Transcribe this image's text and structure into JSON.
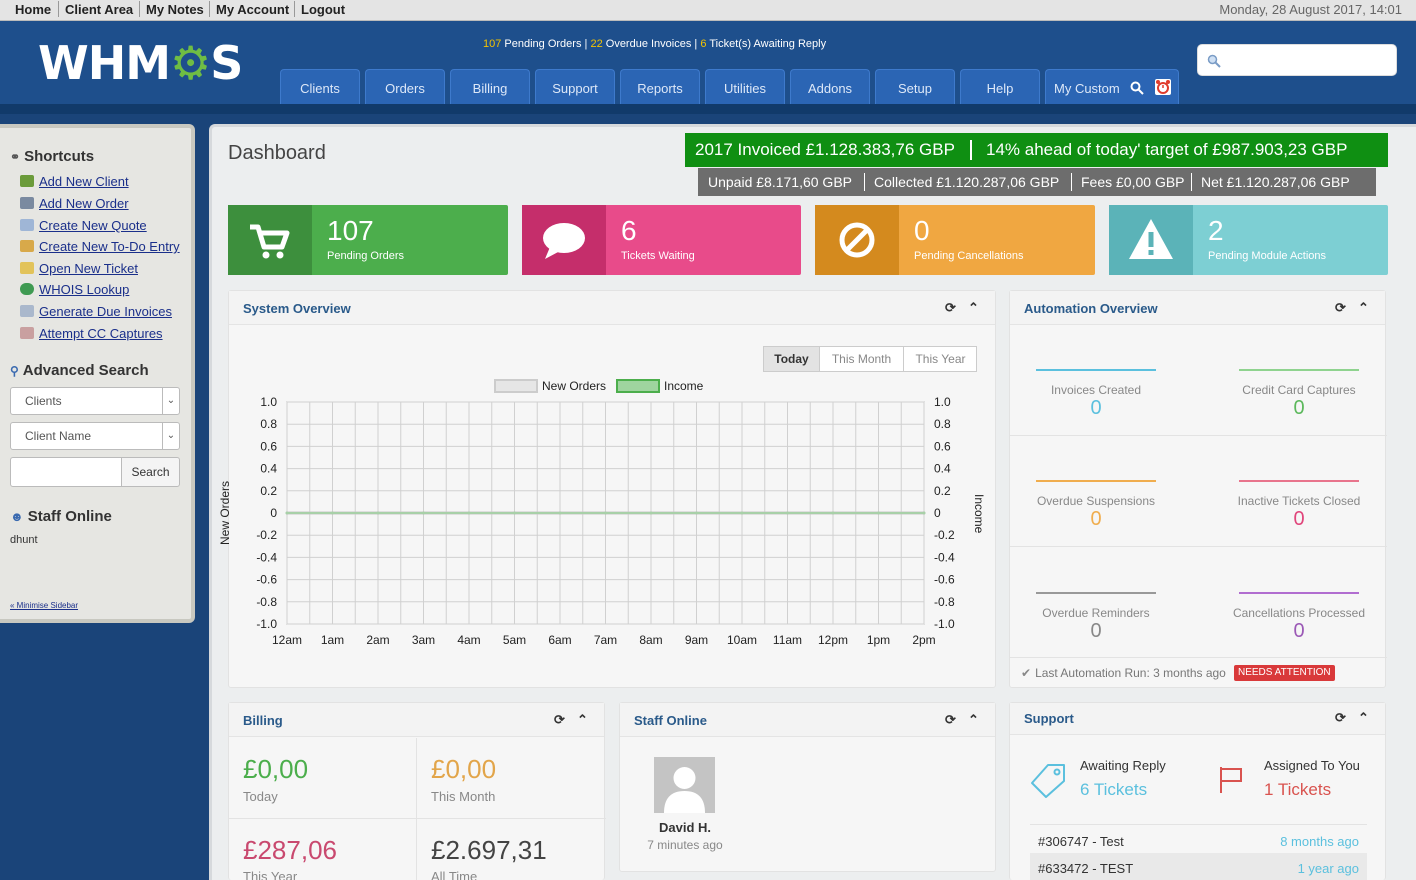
{
  "topnav": {
    "home": "Home",
    "client_area": "Client Area",
    "my_notes": "My Notes",
    "my_account": "My Account",
    "logout": "Logout",
    "datetime": "Monday, 28 August 2017, 14:01"
  },
  "header": {
    "logo_pre": "WHM",
    "logo_gear": "⚙",
    "logo_post": "S",
    "alerts": {
      "pending_orders_n": "107",
      "pending_orders": " Pending Orders",
      "overdue_n": "22",
      "overdue": " Overdue Invoices",
      "tickets_n": "6",
      "tickets": " Ticket(s) Awaiting Reply",
      "sep": " | "
    },
    "tabs": [
      "Clients",
      "Orders",
      "Billing",
      "Support",
      "Reports",
      "Utilities",
      "Addons",
      "Setup",
      "Help",
      "My Custom"
    ]
  },
  "sidebar": {
    "shortcuts_title": "Shortcuts",
    "links": [
      "Add New Client",
      "Add New Order",
      "Create New Quote",
      "Create New To-Do Entry",
      "Open New Ticket",
      "WHOIS Lookup",
      "Generate Due Invoices",
      "Attempt CC Captures"
    ],
    "advanced_search": "Advanced Search",
    "select1": "Clients",
    "select2": "Client Name",
    "search_btn": "Search",
    "staff_online": "Staff Online",
    "staff_name": "dhunt",
    "minimise": "« Minimise Sidebar"
  },
  "dashboard": {
    "title": "Dashboard",
    "invoiced": "2017 Invoiced £1.128.383,76 GBP",
    "ahead": "14% ahead of today' target of £987.903,23 GBP",
    "unpaid": "Unpaid £8.171,60 GBP",
    "collected": "Collected £1.120.287,06 GBP",
    "fees": "Fees £0,00 GBP",
    "net": "Net £1.120.287,06 GBP",
    "stats": [
      {
        "num": "107",
        "label": "Pending Orders"
      },
      {
        "num": "6",
        "label": "Tickets Waiting"
      },
      {
        "num": "0",
        "label": "Pending Cancellations"
      },
      {
        "num": "2",
        "label": "Pending Module Actions"
      }
    ]
  },
  "system_overview": {
    "title": "System Overview",
    "ranges": [
      "Today",
      "This Month",
      "This Year"
    ],
    "legend1": "New Orders",
    "legend2": "Income"
  },
  "chart_data": {
    "type": "line",
    "x": [
      "12am",
      "1am",
      "2am",
      "3am",
      "4am",
      "5am",
      "6am",
      "7am",
      "8am",
      "9am",
      "10am",
      "11am",
      "12pm",
      "1pm",
      "2pm"
    ],
    "y_ticks": [
      "1.0",
      "0.8",
      "0.6",
      "0.4",
      "0.2",
      "0",
      "-0.2",
      "-0.4",
      "-0.6",
      "-0.8",
      "-1.0"
    ],
    "series": [
      {
        "name": "New Orders",
        "values": [
          0,
          0,
          0,
          0,
          0,
          0,
          0,
          0,
          0,
          0,
          0,
          0,
          0,
          0,
          0
        ]
      },
      {
        "name": "Income",
        "values": [
          0,
          0,
          0,
          0,
          0,
          0,
          0,
          0,
          0,
          0,
          0,
          0,
          0,
          0,
          0
        ]
      }
    ],
    "ylabel": "New Orders",
    "y2label": "Income",
    "ylim": [
      -1,
      1
    ],
    "grid": true,
    "legend": "top-center"
  },
  "automation": {
    "title": "Automation Overview",
    "items": [
      {
        "label": "Invoices Created",
        "value": "0",
        "color": "#5bc0de"
      },
      {
        "label": "Credit Card Captures",
        "value": "0",
        "color": "#5cb85c"
      },
      {
        "label": "Overdue Suspensions",
        "value": "0",
        "color": "#f0ad4e"
      },
      {
        "label": "Inactive Tickets Closed",
        "value": "0",
        "color": "#d9534f"
      },
      {
        "label": "Overdue Reminders",
        "value": "0",
        "color": "#777777"
      },
      {
        "label": "Cancellations Processed",
        "value": "0",
        "color": "#9b59b6"
      }
    ],
    "last_run": "Last Automation Run: 3 months ago",
    "needs": "NEEDS ATTENTION"
  },
  "billing": {
    "title": "Billing",
    "today_v": "£0,00",
    "today": "Today",
    "month_v": "£0,00",
    "month": "This Month",
    "year_v": "£287,06",
    "year": "This Year",
    "all_v": "£2.697,31",
    "all": "All Time"
  },
  "staff_panel": {
    "title": "Staff Online",
    "name": "David H.",
    "time": "7 minutes ago"
  },
  "support": {
    "title": "Support",
    "awaiting": "Awaiting Reply",
    "awaiting_v": "6 Tickets",
    "assigned": "Assigned To You",
    "assigned_v": "1 Tickets",
    "tickets": [
      {
        "id": "#306747 - Test",
        "time": "8 months ago"
      },
      {
        "id": "#633472 - TEST",
        "time": "1 year ago"
      }
    ]
  }
}
